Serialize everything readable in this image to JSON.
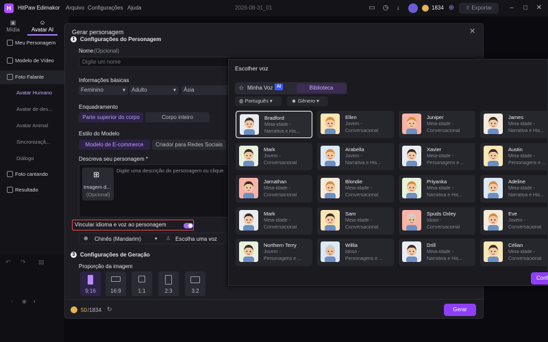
{
  "app": {
    "name": "HitPaw Edimakor",
    "menu": [
      "Arquivo",
      "Configurações",
      "Ajuda"
    ],
    "project_name": "2026-08-31_01",
    "credits": "1834",
    "export_label": "Exportar",
    "accent": "#8e3ff7"
  },
  "top_tabs": [
    {
      "label": "Mídia",
      "icon": "media-icon"
    },
    {
      "label": "Avatar AI",
      "icon": "avatar-icon"
    }
  ],
  "sidebar": {
    "items": [
      {
        "label": "Meu Personagem"
      },
      {
        "label": "Modelo de Vídeo"
      },
      {
        "label": "Foto Falante"
      },
      {
        "label": "Avatar Humano"
      },
      {
        "label": "Avatar de des..."
      },
      {
        "label": "Avatar Animal"
      },
      {
        "label": "Sincronizaçã..."
      },
      {
        "label": "Diálogo"
      },
      {
        "label": "Foto cantando"
      },
      {
        "label": "Resultado"
      }
    ]
  },
  "modal": {
    "title": "Gerar personagem",
    "section1": "Configurações do Personagem",
    "name_label": "Nome",
    "name_optional": "(Opcional)",
    "name_placeholder": "Digite um nome",
    "basic_info_label": "Informações básicas",
    "gender": "Feminino",
    "age": "Adulto",
    "ethnicity": "Ásia",
    "framing_label": "Enquadramento",
    "framing_options": [
      "Parte superior do corpo",
      "Corpo inteiro"
    ],
    "style_label": "Estilo do Modelo",
    "style_options": [
      "Modelo de E-commerce",
      "Criador para Redes Sociais"
    ],
    "describe_label": "Descreva seu personagem *",
    "describe_placeholder": "Digite uma descrição do personagem ou clique",
    "image_label": "Imagem d...",
    "image_optional": "(Opcional)",
    "link_label": "Vincular idioma e voz ao personagem",
    "language": "Chinês (Mandarim)",
    "voice_placeholder": "Escolha uma voz",
    "section2_num": "3",
    "section2": "Configurações de Geração",
    "ratio_label": "Proporção da imagem",
    "ratios": [
      "9:16",
      "16:9",
      "1:1",
      "2:3",
      "3:2"
    ],
    "credits_used": "50",
    "credits_total": "/1834",
    "generate_label": "Gerar"
  },
  "voice_panel": {
    "title": "Escolher voz",
    "tabs": [
      "Minha Voz",
      "Biblioteca"
    ],
    "ai_badge": "AI",
    "filters": [
      "Português",
      "Gênero"
    ],
    "confirm_label": "Confi",
    "voices": [
      {
        "name": "Bradford",
        "d1": "Meia-idade -",
        "d2": "Narrativa e His...",
        "g": "m",
        "selected": true
      },
      {
        "name": "Ellen",
        "d1": "Jovem -",
        "d2": "Conversacional",
        "g": "f"
      },
      {
        "name": "Juniper",
        "d1": "Meia-idade -",
        "d2": "Conversacional",
        "g": "f"
      },
      {
        "name": "James",
        "d1": "Meia-idade -",
        "d2": "Narrativa e His...",
        "g": "m"
      },
      {
        "name": "Mark",
        "d1": "Jovem -",
        "d2": "Conversacional",
        "g": "m"
      },
      {
        "name": "Arabella",
        "d1": "Jovem -",
        "d2": "Narrativa e His...",
        "g": "f"
      },
      {
        "name": "Xavier",
        "d1": "Meia-idade -",
        "d2": "Personagens e ...",
        "g": "m"
      },
      {
        "name": "Austin",
        "d1": "Meia-idade -",
        "d2": "Personagens e ...",
        "g": "m"
      },
      {
        "name": "Jarnathan",
        "d1": "Meia-idade -",
        "d2": "Conversacional",
        "g": "m"
      },
      {
        "name": "Blondie",
        "d1": "Meia-idade -",
        "d2": "Conversacional",
        "g": "f"
      },
      {
        "name": "Priyanka",
        "d1": "Meia-idade -",
        "d2": "Narrativa e His...",
        "g": "f"
      },
      {
        "name": "Adeline",
        "d1": "Meia-idade -",
        "d2": "Narrativa e His...",
        "g": "f"
      },
      {
        "name": "Mark",
        "d1": "Meia-idade -",
        "d2": "Conversacional",
        "g": "m"
      },
      {
        "name": "Sam",
        "d1": "Meia-idade -",
        "d2": "Conversacional",
        "g": "m"
      },
      {
        "name": "Spuds Oxley",
        "d1": "Idoso -",
        "d2": "Conversacional",
        "g": "o"
      },
      {
        "name": "Eve",
        "d1": "Jovem -",
        "d2": "Conversacional",
        "g": "f"
      },
      {
        "name": "Northern Terry",
        "d1": "Jovem -",
        "d2": "Personagens e ...",
        "g": "m"
      },
      {
        "name": "Willia",
        "d1": "Idoso -",
        "d2": "Personagens e ...",
        "g": "o"
      },
      {
        "name": "Drill",
        "d1": "Meia-idade -",
        "d2": "Narrativa e His...",
        "g": "m"
      },
      {
        "name": "Célian",
        "d1": "Meia-idade -",
        "d2": "Conversacional",
        "g": "m"
      }
    ]
  }
}
